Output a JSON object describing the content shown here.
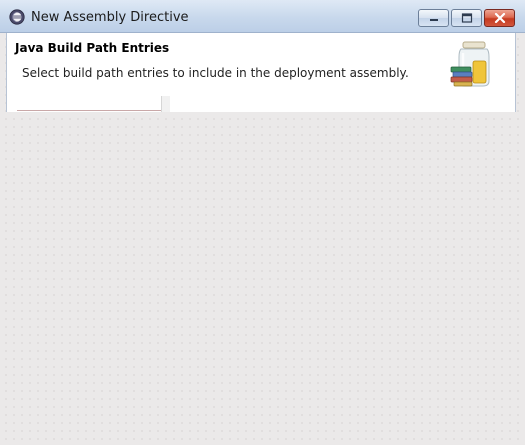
{
  "window": {
    "title": "New Assembly Directive",
    "controls": {
      "minimize_icon": "minimize-icon",
      "maximize_icon": "maximize-icon",
      "close_icon": "close-icon"
    }
  },
  "header": {
    "title": "Java Build Path Entries",
    "description": "Select build path entries to include in the deployment assembly.",
    "banner_icon": "library-jar-icon"
  },
  "colors": {
    "titlebar": "#c8d8ec",
    "close_button": "#c53a1f",
    "content_background": "#ffffff",
    "desktop_background": "#ebe9e9"
  }
}
